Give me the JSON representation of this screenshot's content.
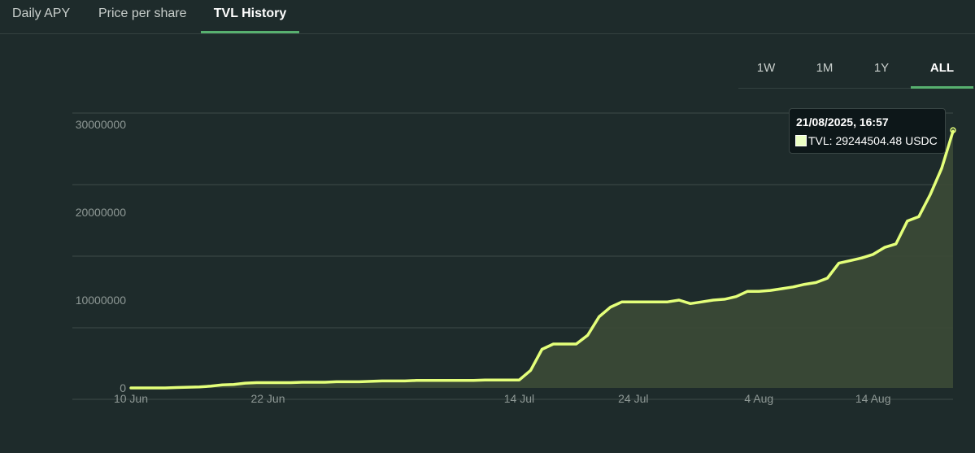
{
  "tabs": [
    {
      "label": "Daily APY",
      "active": false
    },
    {
      "label": "Price per share",
      "active": false
    },
    {
      "label": "TVL History",
      "active": true
    }
  ],
  "ranges": [
    {
      "label": "1W",
      "active": false
    },
    {
      "label": "1M",
      "active": false
    },
    {
      "label": "1Y",
      "active": false
    },
    {
      "label": "ALL",
      "active": true
    }
  ],
  "tooltip": {
    "title": "21/08/2025, 16:57",
    "series_label": "TVL: 29244504.48 USDC"
  },
  "colors": {
    "line": "#e4ff7a",
    "fill": "#3b4a36",
    "grid": "#3e4b4a",
    "tick_text": "#8e9895",
    "accent": "#57b06f"
  },
  "chart_data": {
    "type": "area",
    "title": "",
    "xlabel": "",
    "ylabel": "",
    "x_ticks": [
      "10 Jun",
      "22 Jun",
      "14 Jul",
      "24 Jul",
      "4 Aug",
      "14 Aug"
    ],
    "y_ticks": [
      "0",
      "10000000",
      "20000000",
      "30000000"
    ],
    "ylim": [
      0,
      30000000
    ],
    "grid": true,
    "legend": "none",
    "series": [
      {
        "name": "TVL",
        "unit": "USDC",
        "x": [
          "2025-06-10",
          "2025-06-11",
          "2025-06-12",
          "2025-06-13",
          "2025-06-14",
          "2025-06-15",
          "2025-06-16",
          "2025-06-17",
          "2025-06-18",
          "2025-06-19",
          "2025-06-20",
          "2025-06-21",
          "2025-06-22",
          "2025-06-23",
          "2025-06-24",
          "2025-06-25",
          "2025-06-26",
          "2025-06-27",
          "2025-06-28",
          "2025-06-29",
          "2025-06-30",
          "2025-07-01",
          "2025-07-02",
          "2025-07-03",
          "2025-07-04",
          "2025-07-05",
          "2025-07-06",
          "2025-07-07",
          "2025-07-08",
          "2025-07-09",
          "2025-07-10",
          "2025-07-11",
          "2025-07-12",
          "2025-07-13",
          "2025-07-14",
          "2025-07-15",
          "2025-07-16",
          "2025-07-17",
          "2025-07-18",
          "2025-07-19",
          "2025-07-20",
          "2025-07-21",
          "2025-07-22",
          "2025-07-23",
          "2025-07-24",
          "2025-07-25",
          "2025-07-26",
          "2025-07-27",
          "2025-07-28",
          "2025-07-29",
          "2025-07-30",
          "2025-07-31",
          "2025-08-01",
          "2025-08-02",
          "2025-08-03",
          "2025-08-04",
          "2025-08-05",
          "2025-08-06",
          "2025-08-07",
          "2025-08-08",
          "2025-08-09",
          "2025-08-10",
          "2025-08-11",
          "2025-08-12",
          "2025-08-13",
          "2025-08-14",
          "2025-08-15",
          "2025-08-16",
          "2025-08-17",
          "2025-08-18",
          "2025-08-19",
          "2025-08-20",
          "2025-08-21"
        ],
        "values": [
          0,
          0,
          0,
          0,
          50000,
          80000,
          120000,
          200000,
          350000,
          400000,
          550000,
          600000,
          600000,
          600000,
          600000,
          650000,
          650000,
          650000,
          700000,
          700000,
          700000,
          750000,
          800000,
          800000,
          800000,
          850000,
          850000,
          850000,
          850000,
          850000,
          850000,
          900000,
          900000,
          900000,
          900000,
          2000000,
          4400000,
          5000000,
          5000000,
          5000000,
          6000000,
          8100000,
          9200000,
          9800000,
          9800000,
          9800000,
          9800000,
          9800000,
          10000000,
          9600000,
          9800000,
          10000000,
          10100000,
          10400000,
          11000000,
          11000000,
          11100000,
          11300000,
          11500000,
          11800000,
          12000000,
          12500000,
          14200000,
          14500000,
          14800000,
          15200000,
          16000000,
          16400000,
          19000000,
          19500000,
          22000000,
          25000000,
          29244504.48
        ]
      }
    ]
  }
}
